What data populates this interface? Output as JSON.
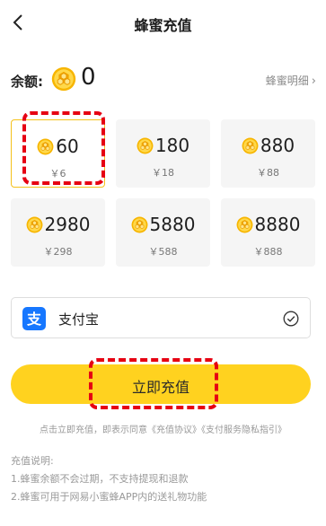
{
  "header": {
    "title": "蜂蜜充值"
  },
  "balance": {
    "label": "余额:",
    "value": "0",
    "detail_link": "蜂蜜明细"
  },
  "packages": [
    {
      "amount": "60",
      "price": "￥6",
      "selected": true
    },
    {
      "amount": "180",
      "price": "￥18",
      "selected": false
    },
    {
      "amount": "880",
      "price": "￥88",
      "selected": false
    },
    {
      "amount": "2980",
      "price": "￥298",
      "selected": false
    },
    {
      "amount": "5880",
      "price": "￥588",
      "selected": false
    },
    {
      "amount": "8880",
      "price": "￥888",
      "selected": false
    }
  ],
  "payment": {
    "method": "支付宝",
    "checked": true
  },
  "button": {
    "label": "立即充值"
  },
  "agreement": {
    "text": "点击立即充值，即表示同意《充值协议》《支付服务隐私指引》"
  },
  "notes": {
    "title": "充值说明:",
    "items": [
      "1.蜂蜜余额不会过期，不支持提现和退款",
      "2.蜂蜜可用于网易小蜜蜂APP内的送礼物功能"
    ]
  },
  "colors": {
    "accent": "#ffd21f",
    "selected_border": "#f5c11a",
    "highlight": "#e60012",
    "alipay": "#1677ff"
  }
}
